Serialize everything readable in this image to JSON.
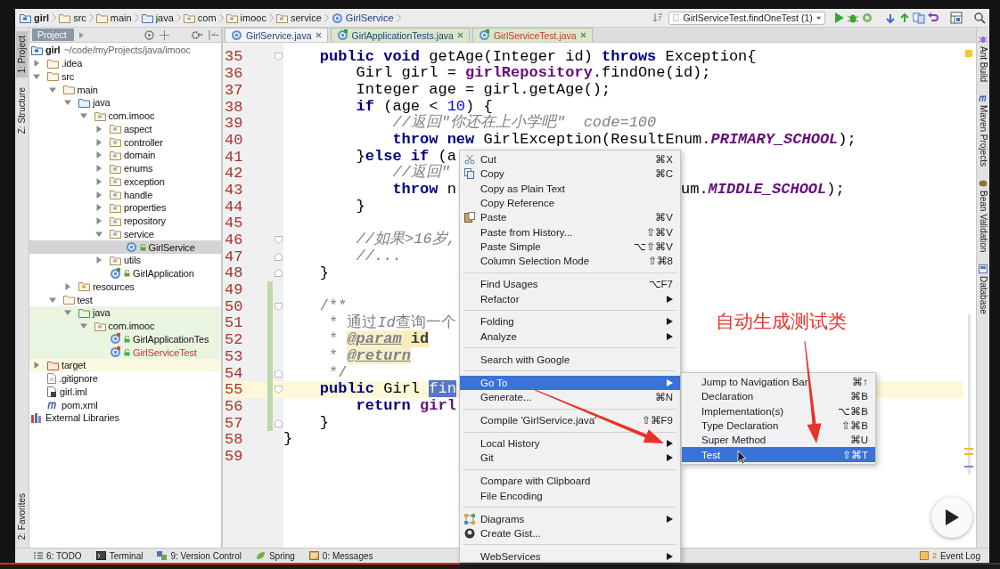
{
  "breadcrumbs": [
    {
      "label": "girl",
      "kind": "module"
    },
    {
      "label": "src",
      "kind": "folder"
    },
    {
      "label": "main",
      "kind": "folder"
    },
    {
      "label": "java",
      "kind": "source"
    },
    {
      "label": "com",
      "kind": "package"
    },
    {
      "label": "imooc",
      "kind": "package"
    },
    {
      "label": "service",
      "kind": "package"
    },
    {
      "label": "GirlService",
      "kind": "class"
    }
  ],
  "run_config": "GirlServiceTest.findOneTest (1)",
  "left_strip": [
    {
      "label": "1: Project",
      "selected": true
    },
    {
      "label": "Z: Structure",
      "selected": false
    },
    {
      "label": "2: Favorites",
      "selected": false
    }
  ],
  "project_panel": {
    "title": "Project",
    "tree": [
      {
        "label": "girl",
        "path": "~/code/myProjects/java/imooc",
        "kind": "module",
        "children": [
          {
            "label": ".idea",
            "kind": "folder",
            "expanded": false
          },
          {
            "label": "src",
            "kind": "folder",
            "expanded": true,
            "children": [
              {
                "label": "main",
                "kind": "folder",
                "expanded": true,
                "children": [
                  {
                    "label": "java",
                    "kind": "source",
                    "expanded": true,
                    "children": [
                      {
                        "label": "com.imooc",
                        "kind": "package",
                        "expanded": true,
                        "children": [
                          {
                            "label": "aspect",
                            "kind": "package",
                            "expanded": false
                          },
                          {
                            "label": "controller",
                            "kind": "package",
                            "expanded": false
                          },
                          {
                            "label": "domain",
                            "kind": "package",
                            "expanded": false
                          },
                          {
                            "label": "enums",
                            "kind": "package",
                            "expanded": false
                          },
                          {
                            "label": "exception",
                            "kind": "package",
                            "expanded": false
                          },
                          {
                            "label": "handle",
                            "kind": "package",
                            "expanded": false
                          },
                          {
                            "label": "properties",
                            "kind": "package",
                            "expanded": false
                          },
                          {
                            "label": "repository",
                            "kind": "package",
                            "expanded": false
                          },
                          {
                            "label": "service",
                            "kind": "package",
                            "expanded": true,
                            "children": [
                              {
                                "label": "GirlService",
                                "kind": "class",
                                "selected": true
                              }
                            ]
                          },
                          {
                            "label": "utils",
                            "kind": "package",
                            "expanded": false
                          },
                          {
                            "label": "GirlApplication",
                            "kind": "app",
                            "selected": false
                          }
                        ]
                      }
                    ]
                  },
                  {
                    "label": "resources",
                    "kind": "resources",
                    "expanded": false
                  }
                ]
              },
              {
                "label": "test",
                "kind": "folder",
                "expanded": true,
                "children": [
                  {
                    "label": "java",
                    "kind": "testsource",
                    "in_test": true,
                    "expanded": true,
                    "children": [
                      {
                        "label": "com.imooc",
                        "kind": "package",
                        "in_test": true,
                        "expanded": true,
                        "children": [
                          {
                            "label": "GirlApplicationTes",
                            "kind": "testclass",
                            "in_test": true,
                            "selected": false,
                            "new_file": false
                          },
                          {
                            "label": "GirlServiceTest",
                            "kind": "testclass",
                            "in_test": true,
                            "selected": false,
                            "new_file": true
                          }
                        ]
                      }
                    ]
                  }
                ]
              }
            ]
          },
          {
            "label": "target",
            "kind": "excluded",
            "excluded": true,
            "expanded": false
          },
          {
            "label": ".gitignore",
            "kind": "file"
          },
          {
            "label": "girl.iml",
            "kind": "iml"
          },
          {
            "label": "pom.xml",
            "kind": "pom"
          }
        ]
      },
      {
        "label": "External Libraries",
        "kind": "libraries"
      }
    ]
  },
  "tabs": [
    {
      "label": "GirlService.java",
      "selected": true,
      "test": false,
      "new_file": false
    },
    {
      "label": "GirlApplicationTests.java",
      "selected": false,
      "test": true,
      "new_file": false
    },
    {
      "label": "GirlServiceTest.java",
      "selected": false,
      "test": true,
      "new_file": true
    }
  ],
  "editor": {
    "lines": [
      {
        "no": "35",
        "fold_start": true,
        "fold_end": false,
        "changed": false,
        "current": false,
        "segments": [
          {
            "kind": "keyword",
            "text": "    public void"
          },
          {
            "kind": "plain",
            "text": " getAge(Integer id) "
          },
          {
            "kind": "keyword",
            "text": "throws"
          },
          {
            "kind": "plain",
            "text": " Exception{"
          }
        ]
      },
      {
        "no": "36",
        "fold_start": false,
        "fold_end": false,
        "changed": false,
        "current": false,
        "segments": [
          {
            "kind": "plain",
            "text": "        Girl girl = "
          },
          {
            "kind": "field",
            "text": "girlRepository"
          },
          {
            "kind": "plain",
            "text": ".findOne(id);"
          }
        ]
      },
      {
        "no": "37",
        "fold_start": false,
        "fold_end": false,
        "changed": false,
        "current": false,
        "segments": [
          {
            "kind": "plain",
            "text": "        Integer age = girl.getAge();"
          }
        ]
      },
      {
        "no": "38",
        "fold_start": false,
        "fold_end": false,
        "changed": false,
        "current": false,
        "segments": [
          {
            "kind": "keyword",
            "text": "        if"
          },
          {
            "kind": "plain",
            "text": " (age < "
          },
          {
            "kind": "number",
            "text": "10"
          },
          {
            "kind": "plain",
            "text": ") {"
          }
        ]
      },
      {
        "no": "39",
        "fold_start": false,
        "fold_end": false,
        "changed": false,
        "current": false,
        "segments": [
          {
            "kind": "comment",
            "text": "            //返回\"你还在上小学吧\"  code=100"
          }
        ]
      },
      {
        "no": "40",
        "fold_start": false,
        "fold_end": false,
        "changed": false,
        "current": false,
        "segments": [
          {
            "kind": "keyword",
            "text": "            throw new"
          },
          {
            "kind": "plain",
            "text": " GirlException(ResultEnum."
          },
          {
            "kind": "constant",
            "text": "PRIMARY_SCHOOL"
          },
          {
            "kind": "plain",
            "text": ");"
          }
        ]
      },
      {
        "no": "41",
        "fold_start": false,
        "fold_end": false,
        "changed": false,
        "current": false,
        "segments": [
          {
            "kind": "plain",
            "text": "        }"
          },
          {
            "kind": "keyword",
            "text": "else if"
          },
          {
            "kind": "plain",
            "text": " (a"
          }
        ]
      },
      {
        "no": "42",
        "fold_start": false,
        "fold_end": false,
        "changed": false,
        "current": false,
        "segments": [
          {
            "kind": "comment",
            "text": "            //返回\""
          }
        ]
      },
      {
        "no": "43",
        "fold_start": false,
        "fold_end": false,
        "changed": false,
        "current": false,
        "segments": [
          {
            "kind": "keyword",
            "text": "            throw"
          },
          {
            "kind": "plain",
            "text": " n"
          }
        ],
        "after_menu": [
          {
            "kind": "plain",
            "text": "um."
          },
          {
            "kind": "constant",
            "text": "MIDDLE_SCHOOL"
          },
          {
            "kind": "plain",
            "text": ");"
          }
        ]
      },
      {
        "no": "44",
        "fold_start": false,
        "fold_end": false,
        "changed": false,
        "current": false,
        "segments": [
          {
            "kind": "plain",
            "text": "        }"
          }
        ]
      },
      {
        "no": "45",
        "fold_start": false,
        "fold_end": false,
        "changed": false,
        "current": false
      },
      {
        "no": "46",
        "fold_start": true,
        "fold_end": false,
        "changed": false,
        "current": false,
        "segments": [
          {
            "kind": "comment",
            "text": "        //如果>16岁,"
          }
        ]
      },
      {
        "no": "47",
        "fold_start": false,
        "fold_end": true,
        "changed": false,
        "current": false,
        "segments": [
          {
            "kind": "comment",
            "text": "        //..."
          }
        ]
      },
      {
        "no": "48",
        "fold_start": false,
        "fold_end": true,
        "changed": false,
        "current": false,
        "segments": [
          {
            "kind": "plain",
            "text": "    }"
          }
        ]
      },
      {
        "no": "49",
        "fold_start": false,
        "fold_end": false,
        "changed": true,
        "current": false
      },
      {
        "no": "50",
        "fold_start": true,
        "fold_end": false,
        "changed": true,
        "current": false,
        "segments": [
          {
            "kind": "doc",
            "text": "    /**"
          }
        ]
      },
      {
        "no": "51",
        "fold_start": false,
        "fold_end": false,
        "changed": true,
        "current": false,
        "segments": [
          {
            "kind": "doc",
            "text": "     * 通过"
          },
          {
            "kind": "doc_italic",
            "text": "Id"
          },
          {
            "kind": "doc",
            "text": "查询一个"
          }
        ]
      },
      {
        "no": "52",
        "fold_start": false,
        "fold_end": false,
        "changed": true,
        "current": false,
        "segments": [
          {
            "kind": "doc",
            "text": "     * "
          },
          {
            "kind": "doc_tag",
            "text": "@param"
          },
          {
            "kind": "doc_param",
            "text": " id"
          }
        ]
      },
      {
        "no": "53",
        "fold_start": false,
        "fold_end": false,
        "changed": true,
        "current": false,
        "segments": [
          {
            "kind": "doc",
            "text": "     * "
          },
          {
            "kind": "doc_tag",
            "text": "@return"
          }
        ]
      },
      {
        "no": "54",
        "fold_start": false,
        "fold_end": true,
        "changed": true,
        "current": false,
        "segments": [
          {
            "kind": "doc",
            "text": "     */"
          }
        ]
      },
      {
        "no": "55",
        "fold_start": true,
        "fold_end": false,
        "changed": true,
        "current": true,
        "segments": [
          {
            "kind": "keyword",
            "text": "    public"
          },
          {
            "kind": "plain",
            "text": " Girl "
          },
          {
            "kind": "selection",
            "text": "fin"
          }
        ]
      },
      {
        "no": "56",
        "fold_start": false,
        "fold_end": false,
        "changed": true,
        "current": false,
        "segments": [
          {
            "kind": "keyword",
            "text": "        return "
          },
          {
            "kind": "field",
            "text": "girl"
          }
        ]
      },
      {
        "no": "57",
        "fold_start": false,
        "fold_end": true,
        "changed": true,
        "current": false,
        "segments": [
          {
            "kind": "plain",
            "text": "    }"
          }
        ]
      },
      {
        "no": "58",
        "fold_start": false,
        "fold_end": false,
        "changed": false,
        "current": false,
        "segments": [
          {
            "kind": "plain",
            "text": "}"
          }
        ]
      },
      {
        "no": "59",
        "fold_start": false,
        "fold_end": false,
        "changed": false,
        "current": false
      }
    ]
  },
  "context_menu": {
    "items": [
      {
        "kind": "item",
        "label": "Cut",
        "shortcut": "⌘X",
        "submenu": false,
        "selected": false
      },
      {
        "kind": "item",
        "label": "Copy",
        "shortcut": "⌘C",
        "submenu": false,
        "selected": false
      },
      {
        "kind": "item",
        "label": "Copy as Plain Text",
        "submenu": false,
        "selected": false
      },
      {
        "kind": "item",
        "label": "Copy Reference",
        "submenu": false,
        "selected": false
      },
      {
        "kind": "item",
        "label": "Paste",
        "shortcut": "⌘V",
        "submenu": false,
        "selected": false
      },
      {
        "kind": "item",
        "label": "Paste from History...",
        "shortcut": "⇧⌘V",
        "submenu": false,
        "selected": false
      },
      {
        "kind": "item",
        "label": "Paste Simple",
        "shortcut": "⌥⇧⌘V",
        "submenu": false,
        "selected": false
      },
      {
        "kind": "item",
        "label": "Column Selection Mode",
        "shortcut": "⇧⌘8",
        "submenu": false,
        "selected": false
      },
      {
        "kind": "separator"
      },
      {
        "kind": "item",
        "label": "Find Usages",
        "shortcut": "⌥F7",
        "submenu": false,
        "selected": false
      },
      {
        "kind": "item",
        "label": "Refactor",
        "submenu": true,
        "selected": false
      },
      {
        "kind": "separator"
      },
      {
        "kind": "item",
        "label": "Folding",
        "submenu": true,
        "selected": false
      },
      {
        "kind": "item",
        "label": "Analyze",
        "submenu": true,
        "selected": false
      },
      {
        "kind": "separator"
      },
      {
        "kind": "item",
        "label": "Search with Google",
        "submenu": false,
        "selected": false
      },
      {
        "kind": "separator"
      },
      {
        "kind": "item",
        "label": "Go To",
        "submenu": true,
        "selected": true
      },
      {
        "kind": "item",
        "label": "Generate...",
        "shortcut": "⌘N",
        "submenu": false,
        "selected": false
      },
      {
        "kind": "separator"
      },
      {
        "kind": "item",
        "label": "Compile 'GirlService.java'",
        "shortcut": "⇧⌘F9",
        "submenu": false,
        "selected": false
      },
      {
        "kind": "separator"
      },
      {
        "kind": "item",
        "label": "Local History",
        "submenu": true,
        "selected": false
      },
      {
        "kind": "item",
        "label": "Git",
        "submenu": true,
        "selected": false
      },
      {
        "kind": "separator"
      },
      {
        "kind": "item",
        "label": "Compare with Clipboard",
        "submenu": false,
        "selected": false
      },
      {
        "kind": "item",
        "label": "File Encoding",
        "submenu": false,
        "selected": false
      },
      {
        "kind": "separator"
      },
      {
        "kind": "item",
        "label": "Diagrams",
        "submenu": true,
        "selected": false
      },
      {
        "kind": "item",
        "label": "Create Gist...",
        "submenu": false,
        "selected": false
      },
      {
        "kind": "separator"
      },
      {
        "kind": "item",
        "label": "WebServices",
        "submenu": true,
        "selected": false
      }
    ]
  },
  "submenu": {
    "items": [
      {
        "label": "Jump to Navigation Bar",
        "shortcut": "⌘↑",
        "selected": false
      },
      {
        "label": "Declaration",
        "shortcut": "⌘B",
        "selected": false
      },
      {
        "label": "Implementation(s)",
        "shortcut": "⌥⌘B",
        "selected": false
      },
      {
        "label": "Type Declaration",
        "shortcut": "⇧⌘B",
        "selected": false
      },
      {
        "label": "Super Method",
        "shortcut": "⌘U",
        "selected": false
      },
      {
        "label": "Test",
        "shortcut": "⇧⌘T",
        "selected": true
      }
    ]
  },
  "annotation": "自动生成测试类",
  "right_strip": [
    {
      "label": "Ant Build"
    },
    {
      "label": "Maven Projects"
    },
    {
      "label": "Bean Validation"
    },
    {
      "label": "Database"
    }
  ],
  "bottom_bar": {
    "tools": [
      {
        "label": "6: TODO"
      },
      {
        "label": "Terminal"
      },
      {
        "label": "9: Version Control"
      },
      {
        "label": "Spring"
      },
      {
        "label": "0: Messages"
      }
    ],
    "event_log": {
      "label": "Event Log",
      "count": "2"
    }
  },
  "video": {
    "progress": {
      "level": 0.46
    }
  }
}
